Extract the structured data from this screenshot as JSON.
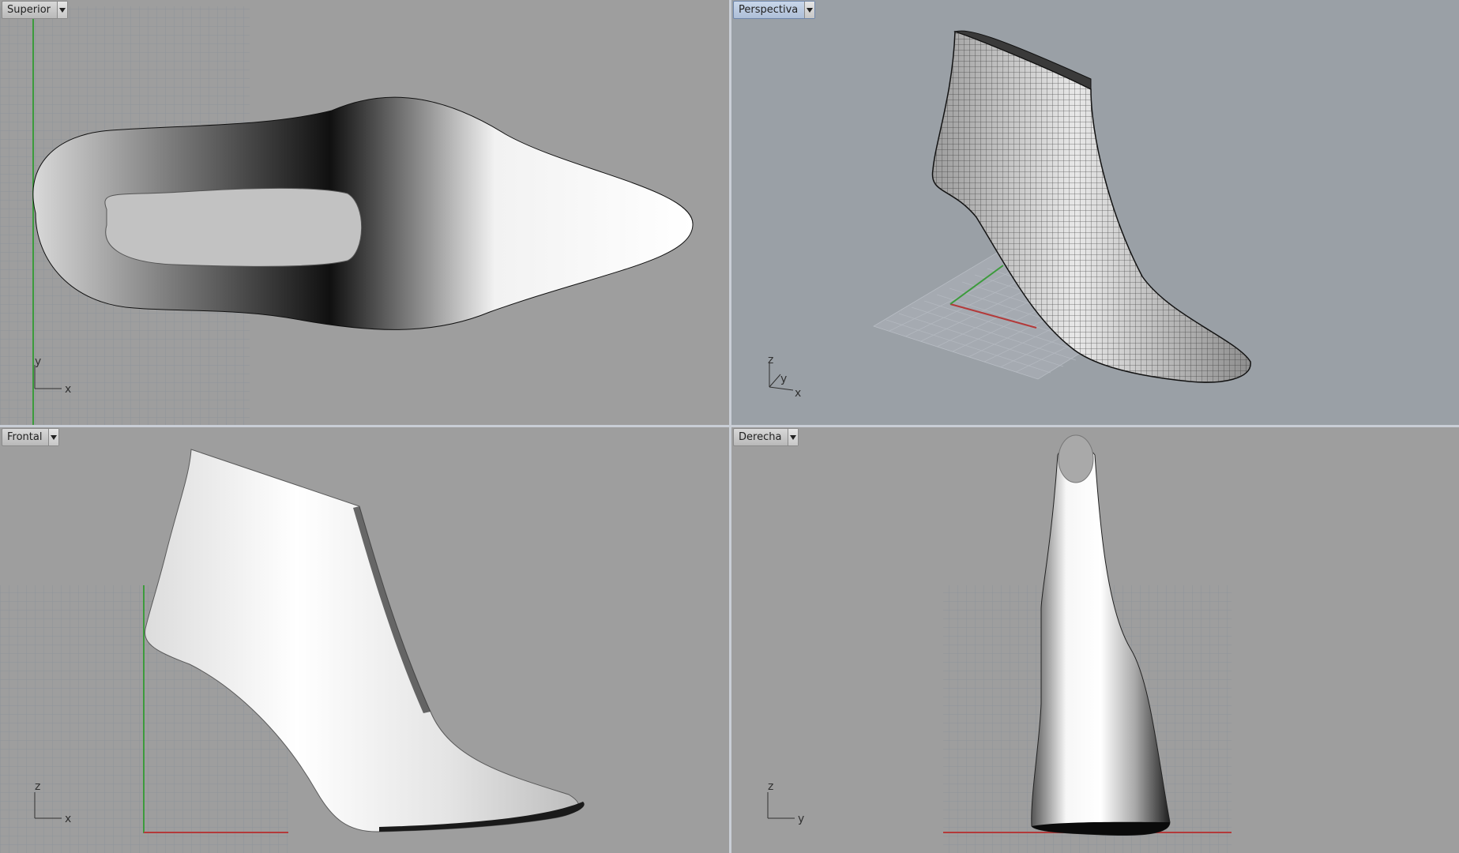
{
  "viewports": {
    "top": {
      "label": "Superior"
    },
    "persp": {
      "label": "Perspectiva"
    },
    "front": {
      "label": "Frontal"
    },
    "right": {
      "label": "Derecha"
    }
  },
  "axis_labels": {
    "top": {
      "a": "y",
      "b": "x"
    },
    "persp": {
      "a": "z",
      "b": "y",
      "c": "x"
    },
    "front": {
      "a": "z",
      "b": "x"
    },
    "right": {
      "a": "z",
      "b": "y"
    }
  },
  "colors": {
    "viewport_bg": "#9e9e9e",
    "persp_bg": "#9aa0a6",
    "grid": "#8c939c",
    "x_axis": "#b33a3a",
    "y_axis": "#3c9b3c",
    "active_label": "#aebfd8"
  },
  "icons": {
    "dropdown": "chevron-down-icon",
    "axis": "axis-triad-icon"
  }
}
